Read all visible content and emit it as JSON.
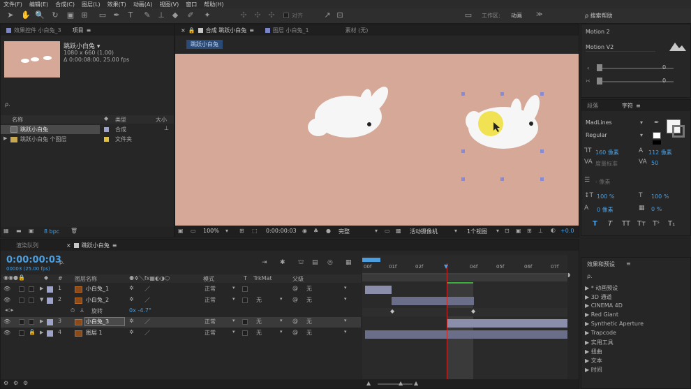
{
  "menu": [
    "文件(F)",
    "编辑(E)",
    "合成(C)",
    "图层(L)",
    "效果(T)",
    "动画(A)",
    "视图(V)",
    "窗口",
    "帮助(H)"
  ],
  "toolbar": {
    "snap_label": "对齐",
    "workspace_label": "工作区:",
    "workspace_value": "动画",
    "search_help": "搜索帮助"
  },
  "project": {
    "tab_effects": "效果控件 小白兔_3",
    "tab_project": "项目",
    "comp_name": "跳跃小白兔 ▾",
    "comp_size": "1080 x 660 (1.00)",
    "comp_duration": "Δ 0:00:08:00, 25.00 fps",
    "search_placeholder": "ρ.",
    "col_name": "名称",
    "col_type": "类型",
    "col_size": "大小",
    "items": [
      {
        "name": "跳跃小白兔",
        "type": "合成",
        "selected": true
      },
      {
        "name": "跳跃小白兔 个图层",
        "type": "文件夹",
        "selected": false
      }
    ],
    "bpc": "8 bpc"
  },
  "viewer": {
    "tab_comp": "合成 跳跃小白兔",
    "tab_layer": "图层 小白兔_1",
    "tab_footage": "素材 (无)",
    "breadcrumb": "跳跃小白兔",
    "zoom": "100%",
    "timecode": "0:00:00:03",
    "quality": "完整",
    "camera": "活动摄像机",
    "views": "1个视图",
    "exposure": "+0.0"
  },
  "right": {
    "motion2": "Motion 2",
    "motionv2": "Motion V2",
    "slider1": "0",
    "slider2": "0",
    "tab_para": "段落",
    "tab_char": "字符",
    "font": "MadLines",
    "style": "Regular",
    "size_val": "160 像素",
    "leading_val": "112 像素",
    "tracking_label": "度量标准",
    "kern_val": "50",
    "stroke_val": "- 像素",
    "vscale": "100 %",
    "hscale": "100 %",
    "baseline": "0 像素",
    "tsume": "0 %"
  },
  "effects": {
    "title": "效果和预设",
    "search": "ρ.",
    "items": [
      "* 动画预设",
      "3D 通道",
      "CINEMA 4D",
      "Red Giant",
      "Synthetic Aperture",
      "Trapcode",
      "实用工具",
      "扭曲",
      "文本",
      "时间"
    ]
  },
  "timeline": {
    "tab_render": "渲染队列",
    "tab_comp": "跳跃小白兔",
    "timecode": "0:00:00:03",
    "frames": "00003 (25.00 fps)",
    "search": "ρ.",
    "col_layer": "图层名称",
    "col_mode": "模式",
    "col_trkmat": "TrkMat",
    "col_parent": "父级",
    "ruler": [
      "00f",
      "01f",
      "02f",
      "03f",
      "04f",
      "05f",
      "06f",
      "07f"
    ],
    "layers": [
      {
        "num": "1",
        "name": "小白兔_1",
        "mode": "正常",
        "trk": "",
        "parent": "无"
      },
      {
        "num": "2",
        "name": "小白兔_2",
        "mode": "正常",
        "trk": "无",
        "parent": "无"
      },
      {
        "num": "3",
        "name": "小白兔_3",
        "mode": "正常",
        "trk": "无",
        "parent": "无"
      },
      {
        "num": "4",
        "name": "图层 1",
        "mode": "正常",
        "trk": "无",
        "parent": "无"
      }
    ],
    "rotation_label": "旋转",
    "rotation_value": "0x -4.7°"
  },
  "colors": {
    "canvas": "#d6a898",
    "accent": "#4b9fe0",
    "playhead": "#c82a2a"
  }
}
